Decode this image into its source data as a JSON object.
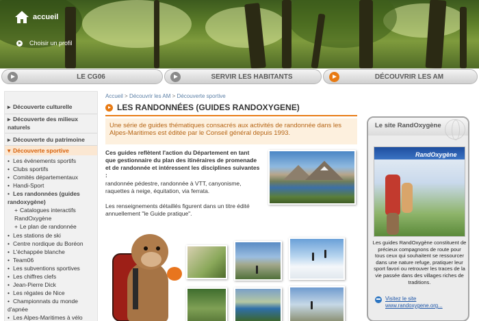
{
  "header": {
    "home_label": "accueil",
    "profile_label": "Choisir un profil"
  },
  "nav": {
    "tabs": [
      {
        "label": "LE CG06",
        "active": false
      },
      {
        "label": "SERVIR LES HABITANTS",
        "active": false
      },
      {
        "label": "DÉCOUVRIR LES AM",
        "active": true
      }
    ]
  },
  "sidebar": {
    "items": [
      {
        "label": "Découverte culturelle",
        "level": "main"
      },
      {
        "label": "Découverte des milieux naturels",
        "level": "main"
      },
      {
        "label": "Découverte du patrimoine",
        "level": "main"
      },
      {
        "label": "Découverte sportive",
        "level": "main",
        "active": true
      },
      {
        "label": "Les événements sportifs",
        "level": "sub"
      },
      {
        "label": "Clubs sportifs",
        "level": "sub"
      },
      {
        "label": "Comités départementaux",
        "level": "sub"
      },
      {
        "label": "Handi-Sport",
        "level": "sub"
      },
      {
        "label": "Les randonnées (guides randoxygène)",
        "level": "sub-bold"
      },
      {
        "label": "Catalogues interactifs RandOxygène",
        "level": "subsub"
      },
      {
        "label": "Le plan de randonnée",
        "level": "subsub"
      },
      {
        "label": "Les stations de ski",
        "level": "sub"
      },
      {
        "label": "Centre nordique du Boréon",
        "level": "sub"
      },
      {
        "label": "L'échappée blanche",
        "level": "sub"
      },
      {
        "label": "Team06",
        "level": "sub"
      },
      {
        "label": "Les subventions sportives",
        "level": "sub"
      },
      {
        "label": "Les chiffres clefs",
        "level": "sub"
      },
      {
        "label": "Jean-Pierre Dick",
        "level": "sub"
      },
      {
        "label": "Les régates de Nice",
        "level": "sub"
      },
      {
        "label": "Championnats du monde d'apnée",
        "level": "sub"
      },
      {
        "label": "Les Alpes-Maritimes à vélo",
        "level": "sub"
      }
    ]
  },
  "breadcrumb": {
    "items": [
      "Accueil",
      "Découvrir les AM",
      "Découverte sportive"
    ],
    "separator": ">"
  },
  "main": {
    "title": "LES RANDONNÉES (GUIDES RANDOXYGENE)",
    "intro": "Une série de guides thématiques consacrés aux activités de randonnée dans les Alpes-Maritimes est éditée par le Conseil général depuis 1993.",
    "body_bold": "Ces guides reflètent l'action du Département en tant que gestionnaire du plan des itinéraires de promenade et de randonnée et intéressent les disciplines suivantes :",
    "body_list": "randonnée pédestre, randonnée à VTT, canyonisme, raquettes à neige, équitation, via ferrata.",
    "body_info": "Les renseignements détaillés figurent dans un titre édité annuellement \"le Guide pratique\"."
  },
  "aside": {
    "title": "Le site RandOxygène",
    "logo_text": "RandOxygène",
    "description": "Les guides RandOxygène constituent de précieux compagnons de route pour tous ceux qui souhaitent se ressourcer dans une nature refuge, pratiquer leur sport favori ou retrouver les traces de la vie passée dans des villages riches de traditions.",
    "link_label": "Visitez le site",
    "link_url_text": "www.randoxygene.org..."
  },
  "colors": {
    "accent": "#e87a13",
    "intro_text": "#b56414",
    "link": "#1d55a8"
  }
}
